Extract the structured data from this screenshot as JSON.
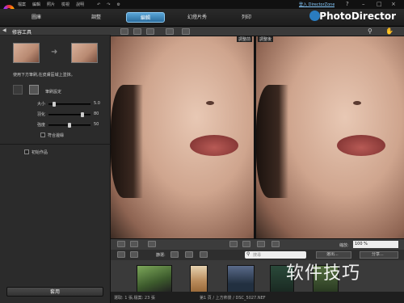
{
  "menu": [
    "檔案",
    "編輯",
    "照片",
    "檢視",
    "說明"
  ],
  "nav": {
    "library": "圖庫",
    "adjust": "調整",
    "edit": "編輯",
    "slideshow": "幻燈片秀",
    "print": "列印"
  },
  "brand": "PhotoDirector",
  "signin": "登入 DirectorZone",
  "window_buttons": [
    "?",
    "–",
    "□",
    "×"
  ],
  "left_panel": {
    "title": "修容工具",
    "instruction": "使用下方筆刷,在皮膚區域上塗抹。",
    "brush_label": "筆刷設定",
    "sliders": [
      {
        "label": "大小",
        "value": "5.0",
        "level": 0.1
      },
      {
        "label": "羽化",
        "value": "80",
        "level": 0.8
      },
      {
        "label": "強度",
        "value": "50",
        "level": 0.5
      }
    ],
    "auto_label": "符合邊緣",
    "reset_label": "初始作品",
    "apply_label": "套用"
  },
  "view": {
    "before": "調整前",
    "after": "調整後"
  },
  "zoom": {
    "label": "縮放:",
    "value": "100 %"
  },
  "filter": {
    "label": "篩選:",
    "search_placeholder": "搜尋"
  },
  "buttons": {
    "select": "選出...",
    "share": "分享..."
  },
  "film_rating": "★★★★",
  "status": {
    "left": "選取: 1 張,檔案: 23 張",
    "right": "第1 頁 / 上方佈景 / DSC_5027.NEF"
  },
  "watermark": "软件技巧",
  "colors": {
    "accent": "#3a8fd0"
  }
}
